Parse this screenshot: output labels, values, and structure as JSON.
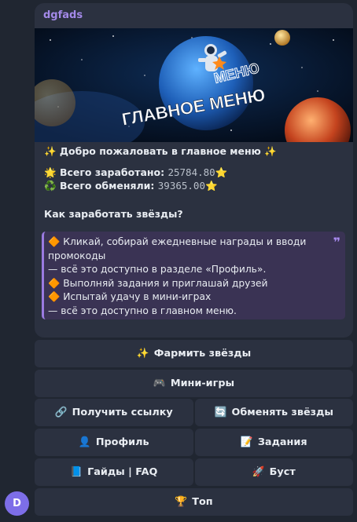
{
  "chat": {
    "sender": "dgfads",
    "banner_title_top": "ГЛАВНОЕ МЕНЮ",
    "banner_title_main": "ГЛАВНОЕ МЕНЮ",
    "welcome": "✨ Добро пожаловать в главное меню ✨",
    "earned_label": "Всего заработано:",
    "earned_value": "25784.80",
    "exchanged_label": "Всего обменяли:",
    "exchanged_value": "39365.00",
    "how_title": "Как заработать звёзды?",
    "quote_lines": [
      "🔶 Кликай, собирай ежедневные награды и вводи промокоды",
      "— всё это доступно в разделе «Профиль».",
      "🔶 Выполняй задания и приглашай друзей",
      "🔶 Испытай удачу в мини-играх",
      "— всё это доступно в главном меню."
    ],
    "quote_mark": "❞"
  },
  "keyboard": {
    "farm": "Фармить звёзды",
    "minigames": "Мини-игры",
    "get_link": "Получить ссылку",
    "exchange": "Обменять звёзды",
    "profile": "Профиль",
    "tasks": "Задания",
    "guides": "Гайды | FAQ",
    "boost": "Буст",
    "top": "Топ"
  },
  "avatar_letter": "D",
  "colors": {
    "background": "#202631",
    "bubble": "#2b3140",
    "sender": "#a389e8",
    "quote_bg": "#3a3354",
    "quote_bar": "#9a7ae0",
    "avatar": "#7d6ee8"
  },
  "icons": {
    "farm": "sparkles-icon",
    "minigames": "gamepad-icon",
    "get_link": "link-icon",
    "exchange": "refresh-icon",
    "profile": "person-icon",
    "tasks": "memo-icon",
    "guides": "book-icon",
    "boost": "rocket-icon",
    "top": "trophy-icon"
  }
}
